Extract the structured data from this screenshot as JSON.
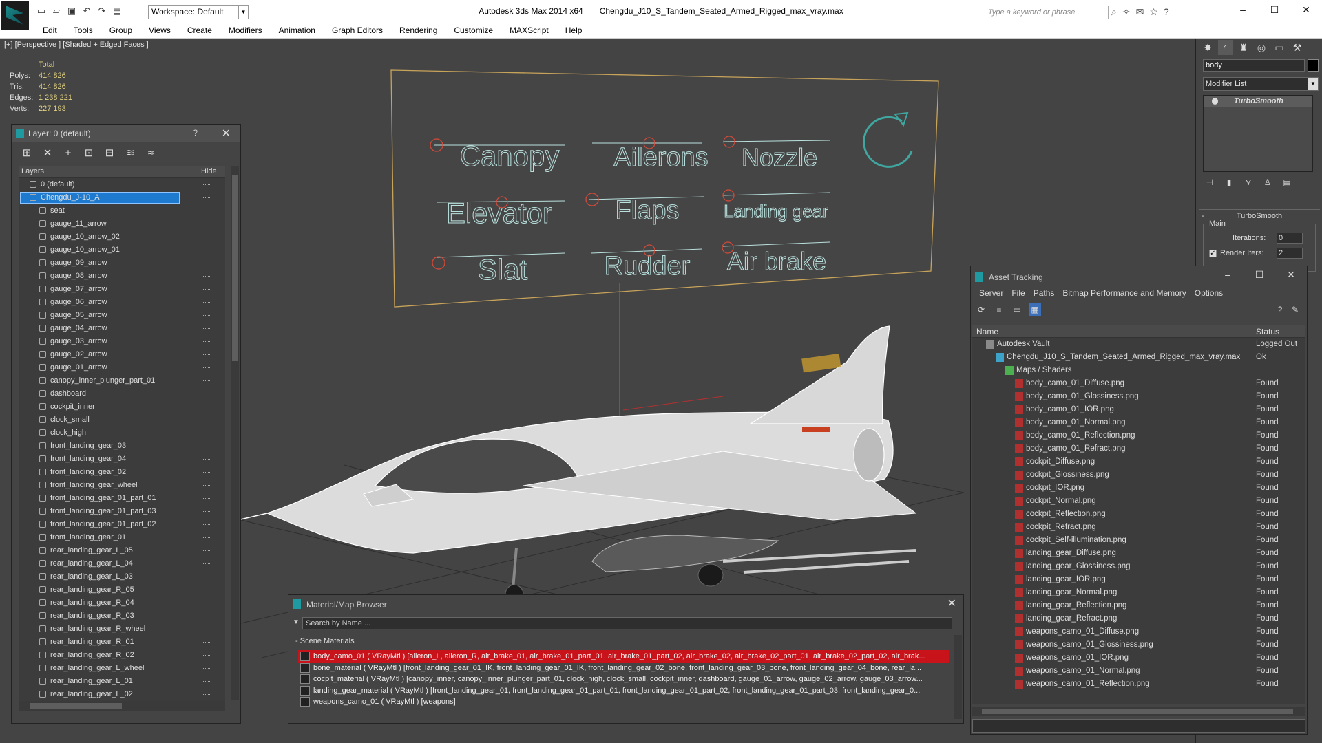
{
  "titlebar": {
    "workspace": "Workspace: Default",
    "app": "Autodesk 3ds Max  2014 x64",
    "file": "Chengdu_J10_S_Tandem_Seated_Armed_Rigged_max_vray.max",
    "search_placeholder": "Type a keyword or phrase",
    "minimize": "–",
    "maximize": "☐",
    "close": "✕"
  },
  "menu": [
    "Edit",
    "Tools",
    "Group",
    "Views",
    "Create",
    "Modifiers",
    "Animation",
    "Graph Editors",
    "Rendering",
    "Customize",
    "MAXScript",
    "Help"
  ],
  "viewport": {
    "label": "[+] [Perspective ] [Shaded + Edged Faces ]",
    "stats": {
      "header": "Total",
      "polys_label": "Polys:",
      "polys": "414 826",
      "tris_label": "Tris:",
      "tris": "414 826",
      "edges_label": "Edges:",
      "edges": "1 238 221",
      "verts_label": "Verts:",
      "verts": "227 193"
    },
    "board_labels": [
      "Canopy",
      "Ailerons",
      "Nozzle",
      "Elevator",
      "Flaps",
      "Landing gear",
      "Slat",
      "Rudder",
      "Air brake"
    ],
    "colors": {
      "wire": "#f2f2f2",
      "board_text": "#b9e1de",
      "board_frame": "#c8a35a",
      "handle": "#d04a3a",
      "grid": "#2a2a2a"
    }
  },
  "layer_panel": {
    "title": "Layer: 0 (default)",
    "help": "?",
    "close": "✕",
    "col_layers": "Layers",
    "col_hide": "Hide",
    "layers": [
      {
        "name": "0 (default)",
        "level": 0
      },
      {
        "name": "Chengdu_J-10_A",
        "level": 0,
        "selected": true
      },
      {
        "name": "seat",
        "level": 1
      },
      {
        "name": "gauge_11_arrow",
        "level": 1
      },
      {
        "name": "gauge_10_arrow_02",
        "level": 1
      },
      {
        "name": "gauge_10_arrow_01",
        "level": 1
      },
      {
        "name": "gauge_09_arrow",
        "level": 1
      },
      {
        "name": "gauge_08_arrow",
        "level": 1
      },
      {
        "name": "gauge_07_arrow",
        "level": 1
      },
      {
        "name": "gauge_06_arrow",
        "level": 1
      },
      {
        "name": "gauge_05_arrow",
        "level": 1
      },
      {
        "name": "gauge_04_arrow",
        "level": 1
      },
      {
        "name": "gauge_03_arrow",
        "level": 1
      },
      {
        "name": "gauge_02_arrow",
        "level": 1
      },
      {
        "name": "gauge_01_arrow",
        "level": 1
      },
      {
        "name": "canopy_inner_plunger_part_01",
        "level": 1
      },
      {
        "name": "dashboard",
        "level": 1
      },
      {
        "name": "cockpit_inner",
        "level": 1
      },
      {
        "name": "clock_small",
        "level": 1
      },
      {
        "name": "clock_high",
        "level": 1
      },
      {
        "name": "front_landing_gear_03",
        "level": 1
      },
      {
        "name": "front_landing_gear_04",
        "level": 1
      },
      {
        "name": "front_landing_gear_02",
        "level": 1
      },
      {
        "name": "front_landing_gear_wheel",
        "level": 1
      },
      {
        "name": "front_landing_gear_01_part_01",
        "level": 1
      },
      {
        "name": "front_landing_gear_01_part_03",
        "level": 1
      },
      {
        "name": "front_landing_gear_01_part_02",
        "level": 1
      },
      {
        "name": "front_landing_gear_01",
        "level": 1
      },
      {
        "name": "rear_landing_gear_L_05",
        "level": 1
      },
      {
        "name": "rear_landing_gear_L_04",
        "level": 1
      },
      {
        "name": "rear_landing_gear_L_03",
        "level": 1
      },
      {
        "name": "rear_landing_gear_R_05",
        "level": 1
      },
      {
        "name": "rear_landing_gear_R_04",
        "level": 1
      },
      {
        "name": "rear_landing_gear_R_03",
        "level": 1
      },
      {
        "name": "rear_landing_gear_R_wheel",
        "level": 1
      },
      {
        "name": "rear_landing_gear_R_01",
        "level": 1
      },
      {
        "name": "rear_landing_gear_R_02",
        "level": 1
      },
      {
        "name": "rear_landing_gear_L_wheel",
        "level": 1
      },
      {
        "name": "rear_landing_gear_L_01",
        "level": 1
      },
      {
        "name": "rear_landing_gear_L_02",
        "level": 1
      }
    ]
  },
  "command_panel": {
    "object_name": "body",
    "modifier_list": "Modifier List",
    "stack_item": "TurboSmooth",
    "rollout_title": "TurboSmooth",
    "group_main": "Main",
    "iterations_label": "Iterations:",
    "iterations": "0",
    "render_iters_label": "Render Iters:",
    "render_iters": "2",
    "render_iters_checked": true
  },
  "asset_tracking": {
    "title": "Asset Tracking",
    "menu": [
      "Server",
      "File",
      "Paths",
      "Bitmap Performance and Memory",
      "Options"
    ],
    "col_name": "Name",
    "col_status": "Status",
    "rows": [
      {
        "name": "Autodesk Vault",
        "status": "Logged Out",
        "level": 0,
        "kind": "vault"
      },
      {
        "name": "Chengdu_J10_S_Tandem_Seated_Armed_Rigged_max_vray.max",
        "status": "Ok",
        "level": 1,
        "kind": "file"
      },
      {
        "name": "Maps / Shaders",
        "status": "",
        "level": 2,
        "kind": "folder"
      },
      {
        "name": "body_camo_01_Diffuse.png",
        "status": "Found",
        "level": 3,
        "kind": "png"
      },
      {
        "name": "body_camo_01_Glossiness.png",
        "status": "Found",
        "level": 3,
        "kind": "png"
      },
      {
        "name": "body_camo_01_IOR.png",
        "status": "Found",
        "level": 3,
        "kind": "png"
      },
      {
        "name": "body_camo_01_Normal.png",
        "status": "Found",
        "level": 3,
        "kind": "png"
      },
      {
        "name": "body_camo_01_Reflection.png",
        "status": "Found",
        "level": 3,
        "kind": "png"
      },
      {
        "name": "body_camo_01_Refract.png",
        "status": "Found",
        "level": 3,
        "kind": "png"
      },
      {
        "name": "cockpit_Diffuse.png",
        "status": "Found",
        "level": 3,
        "kind": "png"
      },
      {
        "name": "cockpit_Glossiness.png",
        "status": "Found",
        "level": 3,
        "kind": "png"
      },
      {
        "name": "cockpit_IOR.png",
        "status": "Found",
        "level": 3,
        "kind": "png"
      },
      {
        "name": "cockpit_Normal.png",
        "status": "Found",
        "level": 3,
        "kind": "png"
      },
      {
        "name": "cockpit_Reflection.png",
        "status": "Found",
        "level": 3,
        "kind": "png"
      },
      {
        "name": "cockpit_Refract.png",
        "status": "Found",
        "level": 3,
        "kind": "png"
      },
      {
        "name": "cockpit_Self-illumination.png",
        "status": "Found",
        "level": 3,
        "kind": "png"
      },
      {
        "name": "landing_gear_Diffuse.png",
        "status": "Found",
        "level": 3,
        "kind": "png"
      },
      {
        "name": "landing_gear_Glossiness.png",
        "status": "Found",
        "level": 3,
        "kind": "png"
      },
      {
        "name": "landing_gear_IOR.png",
        "status": "Found",
        "level": 3,
        "kind": "png"
      },
      {
        "name": "landing_gear_Normal.png",
        "status": "Found",
        "level": 3,
        "kind": "png"
      },
      {
        "name": "landing_gear_Reflection.png",
        "status": "Found",
        "level": 3,
        "kind": "png"
      },
      {
        "name": "landing_gear_Refract.png",
        "status": "Found",
        "level": 3,
        "kind": "png"
      },
      {
        "name": "weapons_camo_01_Diffuse.png",
        "status": "Found",
        "level": 3,
        "kind": "png"
      },
      {
        "name": "weapons_camo_01_Glossiness.png",
        "status": "Found",
        "level": 3,
        "kind": "png"
      },
      {
        "name": "weapons_camo_01_IOR.png",
        "status": "Found",
        "level": 3,
        "kind": "png"
      },
      {
        "name": "weapons_camo_01_Normal.png",
        "status": "Found",
        "level": 3,
        "kind": "png"
      },
      {
        "name": "weapons_camo_01_Reflection.png",
        "status": "Found",
        "level": 3,
        "kind": "png"
      }
    ]
  },
  "material_browser": {
    "title": "Material/Map Browser",
    "search_placeholder": "Search by Name ...",
    "section": "Scene Materials",
    "materials": [
      {
        "text": "body_camo_01  ( VRayMtl ) [aileron_L, aileron_R, air_brake_01, air_brake_01_part_01, air_brake_01_part_02, air_brake_02, air_brake_02_part_01, air_brake_02_part_02, air_brak...",
        "selected": true
      },
      {
        "text": "bone_material  ( VRayMtl ) [front_landing_gear_01_IK, front_landing_gear_01_IK, front_landing_gear_02_bone, front_landing_gear_03_bone, front_landing_gear_04_bone, rear_la...",
        "selected": false
      },
      {
        "text": "cocpit_material  ( VRayMtl ) [canopy_inner, canopy_inner_plunger_part_01, clock_high, clock_small, cockpit_inner, dashboard, gauge_01_arrow, gauge_02_arrow, gauge_03_arrow...",
        "selected": false
      },
      {
        "text": "landing_gear_material  ( VRayMtl ) [front_landing_gear_01, front_landing_gear_01_part_01, front_landing_gear_01_part_02, front_landing_gear_01_part_03, front_landing_gear_0...",
        "selected": false
      },
      {
        "text": "weapons_camo_01  ( VRayMtl ) [weapons]",
        "selected": false
      }
    ]
  }
}
